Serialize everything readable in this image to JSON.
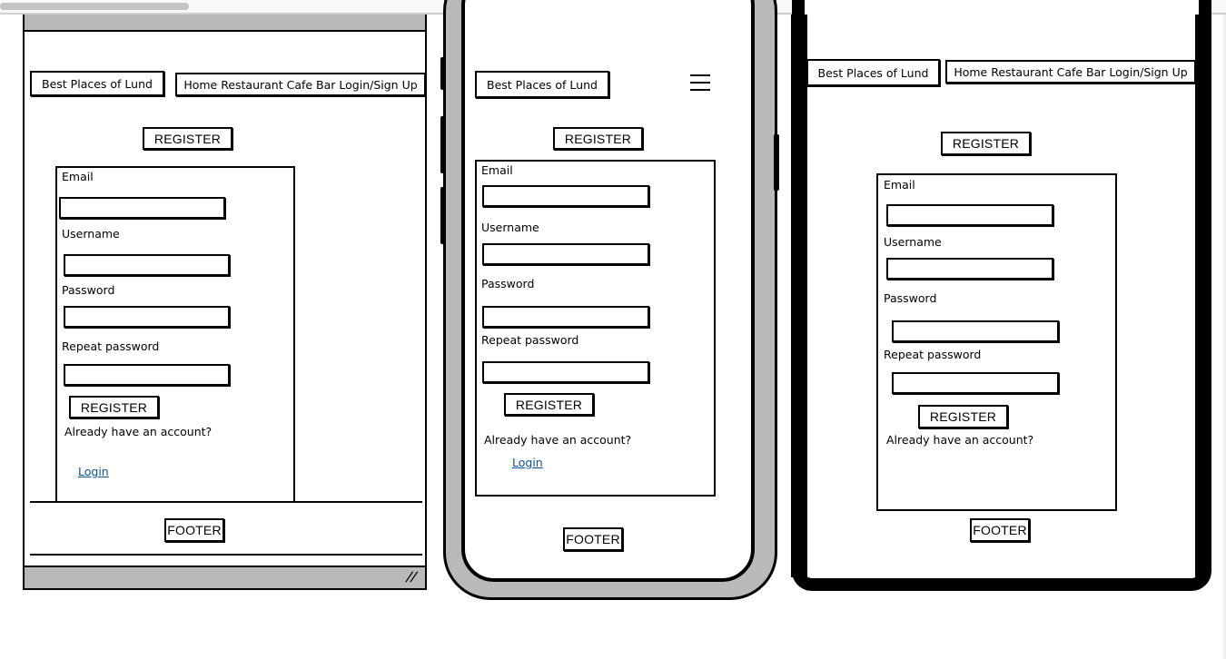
{
  "colors": {
    "frame_gray": "#b9b9b9",
    "link": "#0b5394",
    "ink": "#000000"
  },
  "desktop": {
    "brand": "Best Places of Lund",
    "nav": "Home Restaurant Cafe Bar Login/Sign Up",
    "heading": "REGISTER",
    "form": {
      "email_label": "Email",
      "username_label": "Username",
      "password_label": "Password",
      "repeat_label": "Repeat password",
      "submit_label": "REGISTER",
      "prompt": "Already have an account?",
      "login_link": "Login"
    },
    "footer": "FOOTER"
  },
  "mobile": {
    "brand": "Best Places of Lund",
    "menu_icon": "hamburger-icon",
    "heading": "REGISTER",
    "form": {
      "email_label": "Email",
      "username_label": "Username",
      "password_label": "Password",
      "repeat_label": "Repeat password",
      "submit_label": "REGISTER",
      "prompt": "Already have an account?",
      "login_link": "Login"
    },
    "footer": "FOOTER"
  },
  "tablet": {
    "brand": "Best Places of Lund",
    "nav": "Home Restaurant Cafe Bar Login/Sign Up",
    "heading": "REGISTER",
    "form": {
      "email_label": "Email",
      "username_label": "Username",
      "password_label": "Password",
      "repeat_label": "Repeat password",
      "submit_label": "REGISTER",
      "prompt": "Already have an account?"
    },
    "footer": "FOOTER"
  }
}
